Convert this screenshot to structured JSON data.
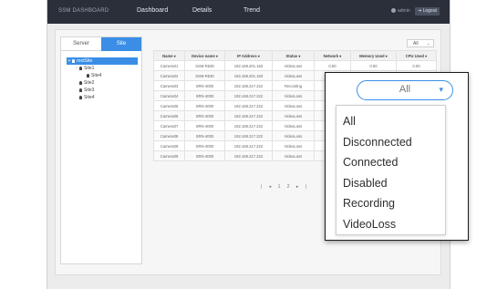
{
  "header": {
    "brand": "SSM DASHBOARD",
    "nav": [
      "Dashboard",
      "Details",
      "Trend"
    ],
    "user": "admin",
    "logout_label": "Logout"
  },
  "left_panel": {
    "tabs": [
      "Server",
      "Site"
    ],
    "active_tab": "Site",
    "tree": [
      {
        "label": "rootSite",
        "depth": 0,
        "toggle": "+",
        "selected": true
      },
      {
        "label": "Site1",
        "depth": 1,
        "toggle": "-",
        "selected": false
      },
      {
        "label": "Site4",
        "depth": 2,
        "toggle": "",
        "selected": false
      },
      {
        "label": "Site2",
        "depth": 1,
        "toggle": "",
        "selected": false
      },
      {
        "label": "Site3",
        "depth": 1,
        "toggle": "",
        "selected": false
      },
      {
        "label": "Site4",
        "depth": 1,
        "toggle": "",
        "selected": false
      }
    ]
  },
  "status_filter": {
    "selected": "All",
    "options": [
      "All",
      "Disconnected",
      "Connected",
      "Disabled",
      "Recording",
      "VideoLoss"
    ]
  },
  "table": {
    "columns": [
      "Name",
      "Device name",
      "IP Address",
      "Status",
      "Network",
      "Memory Used",
      "CPU Used"
    ],
    "rows": [
      [
        "Camera01",
        "SSM-R530",
        "192.168.201.183",
        "VideoLoss",
        "0.00",
        "0.00",
        "0.00"
      ],
      [
        "Camera02",
        "SSM-R530",
        "192.168.201.183",
        "VideoLoss",
        "",
        "",
        ""
      ],
      [
        "Camera03",
        "SRN-4000",
        "192.168.217.222",
        "Recording",
        "",
        "",
        ""
      ],
      [
        "Camera04",
        "SRN-4000",
        "192.168.217.222",
        "VideoLoss",
        "",
        "",
        ""
      ],
      [
        "Camera05",
        "SRN-4000",
        "192.168.217.222",
        "VideoLoss",
        "",
        "",
        ""
      ],
      [
        "Camera06",
        "SRN-4000",
        "192.168.217.222",
        "VideoLoss",
        "",
        "",
        ""
      ],
      [
        "Camera07",
        "SRN-4000",
        "192.168.217.222",
        "VideoLoss",
        "",
        "",
        ""
      ],
      [
        "Camera08",
        "SRN-4000",
        "192.168.217.222",
        "VideoLoss",
        "",
        "",
        ""
      ],
      [
        "Camera09",
        "SRN-4000",
        "192.168.217.222",
        "VideoLoss",
        "",
        "",
        ""
      ],
      [
        "Camera09",
        "SRN-4000",
        "192.168.217.222",
        "VideoLoss",
        "",
        "",
        ""
      ]
    ]
  },
  "pager": "|  ◂  1 2  ▸  |",
  "colors": {
    "accent": "#3a8ee6",
    "topbar": "#2a2f3a"
  }
}
